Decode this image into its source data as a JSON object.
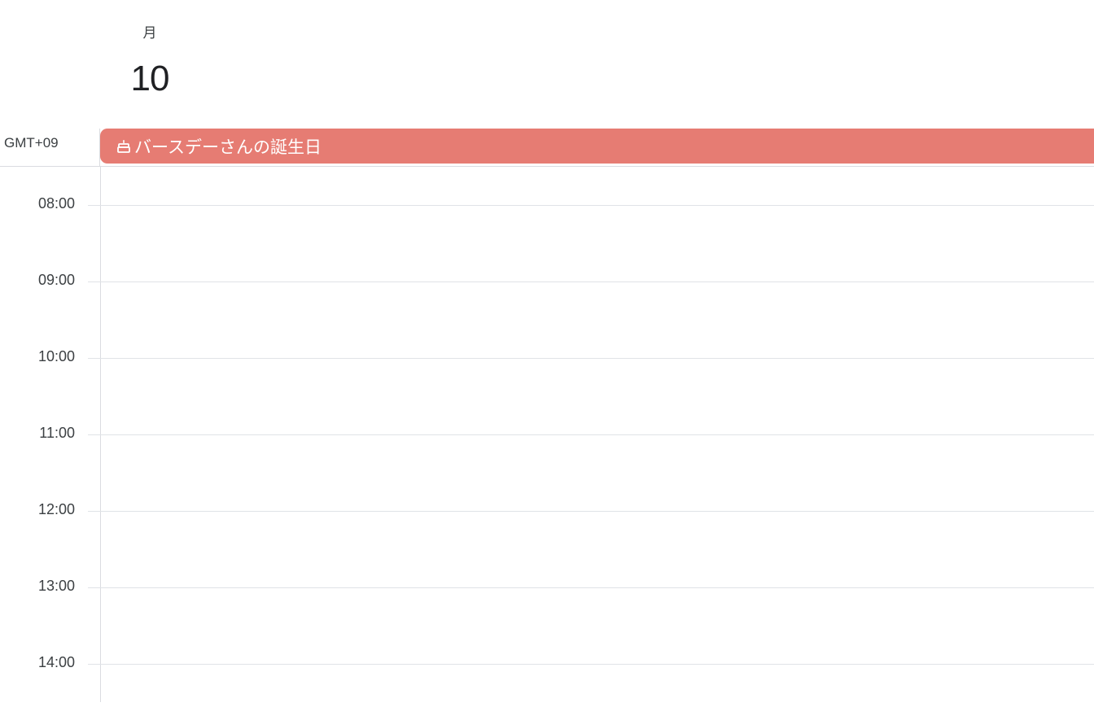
{
  "day_header": {
    "weekday": "月",
    "day_number": "10"
  },
  "timezone_label": "GMT+09",
  "allday_events": [
    {
      "icon": "cake-icon",
      "title": "バースデーさんの誕生日",
      "color": "#e67c73"
    }
  ],
  "hours": [
    {
      "label": "08:00"
    },
    {
      "label": "09:00"
    },
    {
      "label": "10:00"
    },
    {
      "label": "11:00"
    },
    {
      "label": "12:00"
    },
    {
      "label": "13:00"
    },
    {
      "label": "14:00"
    }
  ],
  "colors": {
    "event_red": "#e67c73",
    "grid_line": "#e0e3e7",
    "text": "#3c4043"
  }
}
